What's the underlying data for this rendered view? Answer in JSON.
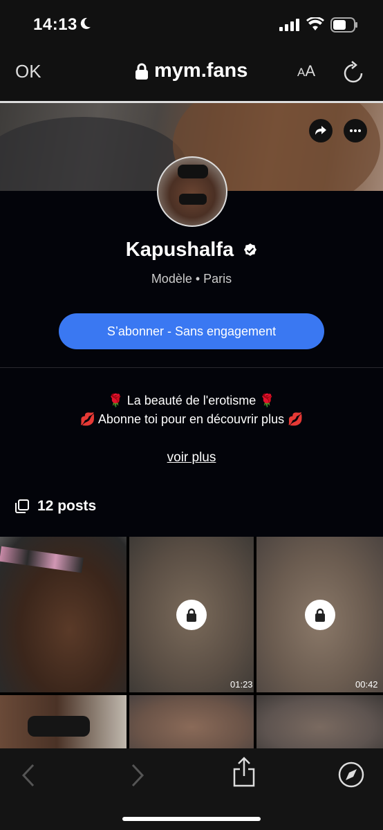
{
  "status_bar": {
    "time": "14:13"
  },
  "browser": {
    "close_label": "OK",
    "domain": "mym.fans",
    "text_size_small": "A",
    "text_size_large": "A"
  },
  "profile": {
    "name": "Kapushalfa",
    "subtitle": "Modèle • Paris",
    "subscribe_label": "S’abonner - Sans engagement",
    "bio_line1": "🌹 La beauté de l'erotisme 🌹",
    "bio_line2": "💋 Abonne toi pour en découvrir plus 💋",
    "see_more": "voir plus",
    "posts_count": "12 posts"
  },
  "posts": [
    {
      "locked": false,
      "duration": ""
    },
    {
      "locked": true,
      "duration": "01:23"
    },
    {
      "locked": true,
      "duration": "00:42"
    },
    {
      "locked": false,
      "duration": ""
    },
    {
      "locked": true,
      "duration": ""
    },
    {
      "locked": true,
      "duration": ""
    }
  ],
  "colors": {
    "accent": "#3a78f2",
    "background": "#03040a",
    "bar": "#111111"
  }
}
